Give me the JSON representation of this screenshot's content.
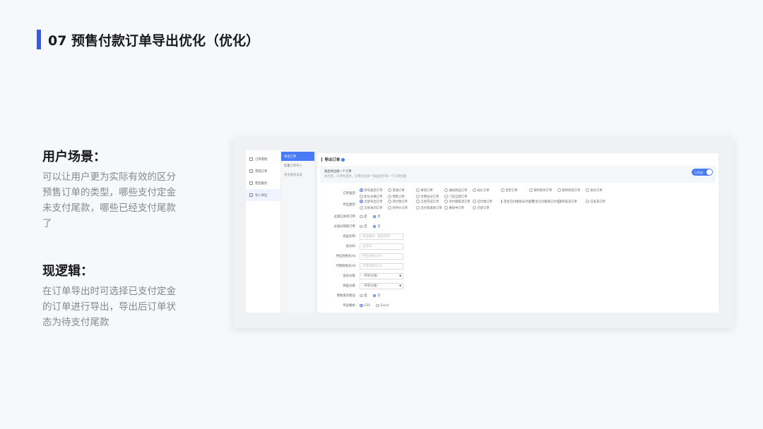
{
  "slide": {
    "title": "07 预售付款订单导出优化（优化）",
    "sections": [
      {
        "heading": "用户场景：",
        "body": "可以让用户更为实际有效的区分预售订单的类型，哪些支付定金未支付尾款，哪些已经支付尾款了"
      },
      {
        "heading": "现逻辑：",
        "body": "在订单导出时可选择已支付定金的订单进行导出，导出后订单状态为待支付尾款"
      }
    ]
  },
  "screenshot": {
    "nav_primary": [
      {
        "label": "订单管理",
        "icon": "order-icon",
        "active": false
      },
      {
        "label": "营销订单",
        "icon": "marketing-icon",
        "active": false
      },
      {
        "label": "售后服务",
        "icon": "service-icon",
        "active": false
      },
      {
        "label": "导入导出",
        "icon": "import-export-icon",
        "active": true
      }
    ],
    "nav_secondary": [
      {
        "label": "导出订单",
        "active": true
      },
      {
        "label": "批量订单导入",
        "active": false
      },
      {
        "label": "导出查询记录",
        "active": false
      }
    ],
    "panel_title": "导出订单",
    "banner": {
      "line1": "商品导出按一个订单",
      "line2": "开启后，订单导出时，订单包含多个商品显示到一个订单里面",
      "toggle_label": "已开启"
    },
    "order_type": {
      "label": "订单类型:",
      "options": [
        "所有类型订单",
        "普通订单",
        "拼团订单",
        "虚拟商品订单",
        "砍价订单",
        "定金订单",
        "限时秒杀订单",
        "限时折扣订单",
        "助力订单",
        "积分兑换订单",
        "预售订单",
        "付费会员订单",
        "门店自提订单"
      ]
    },
    "export_type": {
      "label": "导出类型:",
      "options": [
        "全部导出订单",
        "待付款订单",
        "交易完成订单",
        "待付款取消订单",
        "已付款订单",
        "定金已付尾款未付订单",
        "定金已付尾款已付订单",
        "待发货订单",
        "已发货订单",
        "交易关闭订单",
        "待评价订单",
        "已付款退款订单",
        "维权中订单",
        "全部订单"
      ]
    },
    "fields": [
      {
        "label": "过滤已关闭订单:",
        "kind": "radio",
        "options": [
          "是",
          "否"
        ],
        "selected": 1
      },
      {
        "label": "过滤分销商订单:",
        "kind": "radio",
        "options": [
          "是",
          "否"
        ],
        "selected": 1
      },
      {
        "label": "商品名称:",
        "kind": "input",
        "placeholder": "商品编码、商品名称"
      },
      {
        "label": "会员ID:",
        "kind": "input",
        "placeholder": "会员ID"
      },
      {
        "label": "供应商姓名/id:",
        "kind": "input",
        "placeholder": "供应商姓名/id"
      },
      {
        "label": "代理商姓名/id:",
        "kind": "input",
        "placeholder": "代理商姓名/id"
      },
      {
        "label": "会员分组:",
        "kind": "select",
        "value": "--所有分组--"
      },
      {
        "label": "商品分类:",
        "kind": "select",
        "value": "--所有分类--"
      },
      {
        "label": "原始发货地址:",
        "kind": "radio",
        "options": [
          "是",
          "否"
        ],
        "selected": 1
      },
      {
        "label": "导出格式:",
        "kind": "radio",
        "options": [
          "CSV",
          "Excel"
        ],
        "selected": 0
      }
    ]
  }
}
